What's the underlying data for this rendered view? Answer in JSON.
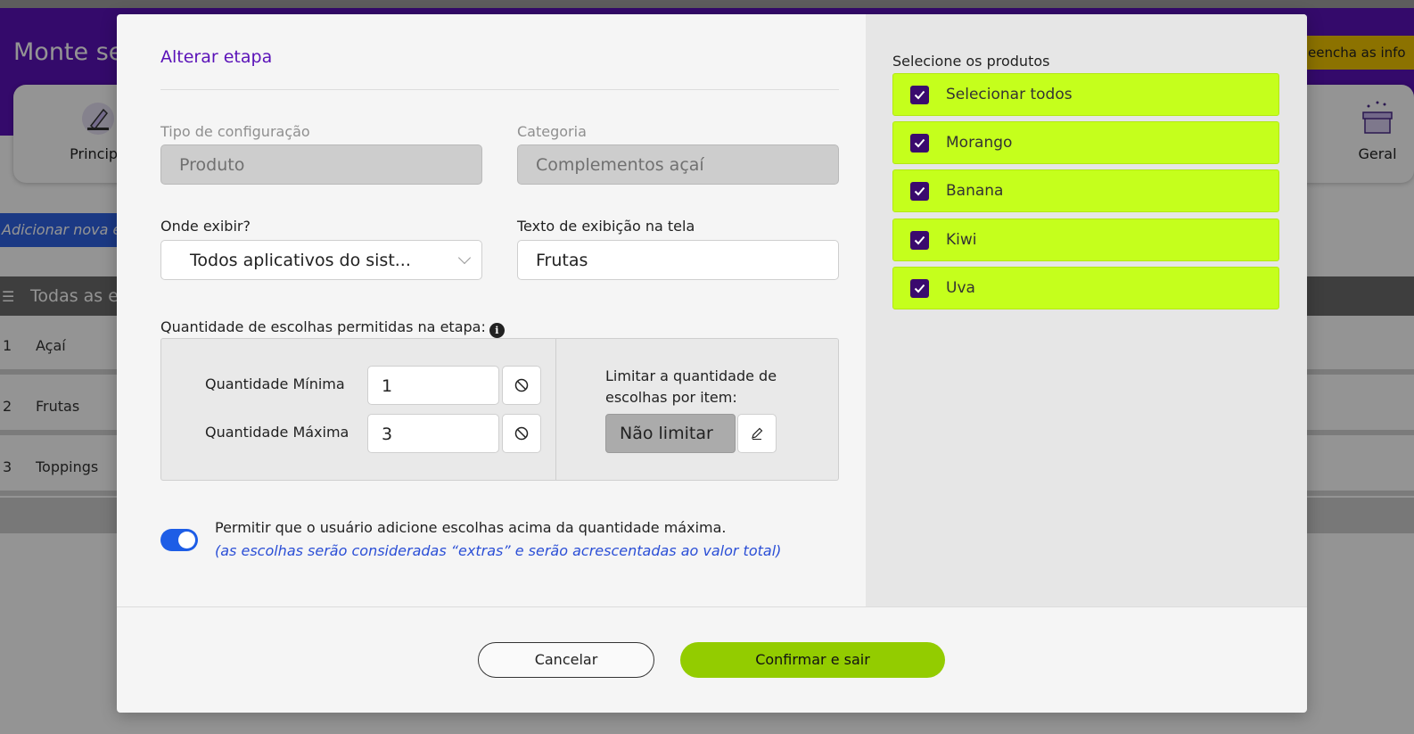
{
  "background": {
    "page_title": "Monte se",
    "header_hint": "eencha as info",
    "tabs": [
      {
        "label": "Principa",
        "icon": "pencil-icon"
      },
      {
        "label": "Geral",
        "icon": "gift-box-icon"
      }
    ],
    "add_step_button": "Adicionar nova eta",
    "list_header": "Todas as et",
    "rows": [
      {
        "number": "1",
        "name": "Açaí"
      },
      {
        "number": "2",
        "name": "Frutas"
      },
      {
        "number": "3",
        "name": "Toppings"
      }
    ]
  },
  "modal": {
    "title": "Alterar etapa",
    "config_type": {
      "label": "Tipo de configuração",
      "value": "Produto"
    },
    "category": {
      "label": "Categoria",
      "value": "Complementos açaí"
    },
    "display_where": {
      "label": "Onde exibir?",
      "value": "Todos aplicativos do sist..."
    },
    "display_text": {
      "label": "Texto de exibição na tela",
      "value": "Frutas"
    },
    "quantity": {
      "section_label": "Quantidade de escolhas permitidas na etapa:",
      "min_label": "Quantidade Mínima",
      "min_value": "1",
      "max_label": "Quantidade Máxima",
      "max_value": "3",
      "limit_label_line1": "Limitar a quantidade de",
      "limit_label_line2": "escolhas por item:",
      "limit_value": "Não limitar"
    },
    "allow_extra": {
      "enabled": true,
      "text": "Permitir que o usuário adicione escolhas acima da quantidade máxima.",
      "note": "(as escolhas serão consideradas “extras” e serão acrescentadas ao valor total)"
    },
    "products": {
      "title": "Selecione os produtos",
      "items": [
        {
          "label": "Selecionar todos",
          "checked": true
        },
        {
          "label": "Morango",
          "checked": true
        },
        {
          "label": "Banana",
          "checked": true
        },
        {
          "label": "Kiwi",
          "checked": true
        },
        {
          "label": "Uva",
          "checked": true
        }
      ]
    },
    "cancel_label": "Cancelar",
    "confirm_label": "Confirmar e sair"
  },
  "colors": {
    "brand_purple": "#5a12b8",
    "accent_green": "#93cc00",
    "product_highlight": "#c5ff1c",
    "toggle_blue": "#1d5de6"
  }
}
